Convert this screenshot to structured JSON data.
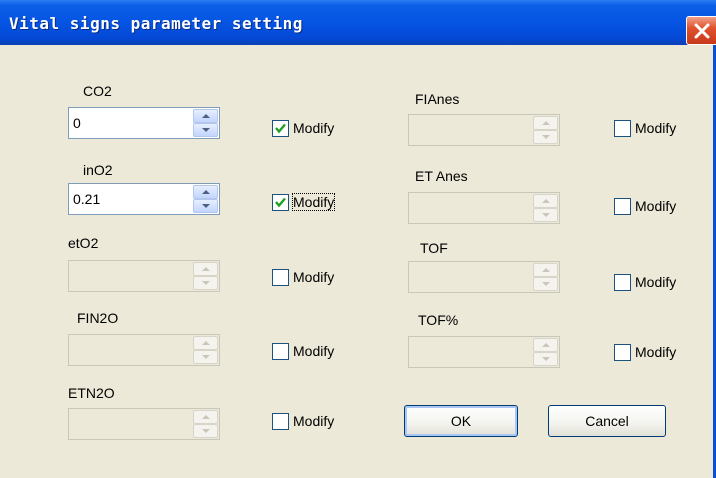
{
  "window": {
    "title": "Vital signs parameter setting"
  },
  "left_column": [
    {
      "label": "CO2",
      "value": "0",
      "enabled": true,
      "checked": true
    },
    {
      "label": "inO2",
      "value": "0.21",
      "enabled": true,
      "checked": true
    },
    {
      "label": "etO2",
      "value": "",
      "enabled": false,
      "checked": false
    },
    {
      "label": "FIN2O",
      "value": "",
      "enabled": false,
      "checked": false
    },
    {
      "label": "ETN2O",
      "value": "",
      "enabled": false,
      "checked": false
    }
  ],
  "right_column": [
    {
      "label": "FIAnes",
      "value": "",
      "enabled": false,
      "checked": false
    },
    {
      "label": "ET Anes",
      "value": "",
      "enabled": false,
      "checked": false
    },
    {
      "label": "TOF",
      "value": "",
      "enabled": false,
      "checked": false
    },
    {
      "label": "TOF%",
      "value": "",
      "enabled": false,
      "checked": false
    }
  ],
  "checkbox_label": "Modify",
  "buttons": {
    "ok": "OK",
    "cancel": "Cancel"
  },
  "icons": [
    "close-icon",
    "checkmark-icon",
    "spin-up-icon",
    "spin-down-icon"
  ],
  "colors": {
    "titlebar": "#0554e3",
    "dialog_bg": "#ece9d8",
    "close": "#e0532f"
  }
}
